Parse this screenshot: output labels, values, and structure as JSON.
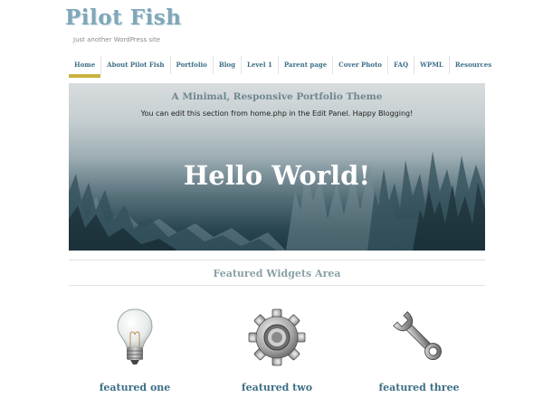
{
  "site": {
    "title": "Pilot Fish",
    "tagline": "Just another WordPress site"
  },
  "nav": {
    "items": [
      {
        "label": "Home",
        "active": true
      },
      {
        "label": "About Pilot Fish"
      },
      {
        "label": "Portfolio"
      },
      {
        "label": "Blog"
      },
      {
        "label": "Level 1"
      },
      {
        "label": "Parent page"
      },
      {
        "label": "Cover Photo"
      },
      {
        "label": "FAQ"
      },
      {
        "label": "WPML"
      },
      {
        "label": "Resources"
      }
    ]
  },
  "hero": {
    "subtitle": "A Minimal, Responsive Portfolio Theme",
    "text": "You can edit this section from home.php in the Edit Panel. Happy Blogging!",
    "heading": "Hello World!"
  },
  "featured": {
    "heading": "Featured Widgets Area",
    "widgets": [
      {
        "title": "featured one",
        "icon": "light-bulb-icon"
      },
      {
        "title": "featured two",
        "icon": "gear-icon"
      },
      {
        "title": "featured three",
        "icon": "wrench-icon"
      }
    ]
  },
  "colors": {
    "link": "#3d6f86",
    "nav_active_underline": "#c9b23f",
    "heading_muted": "#8aa1a6"
  }
}
